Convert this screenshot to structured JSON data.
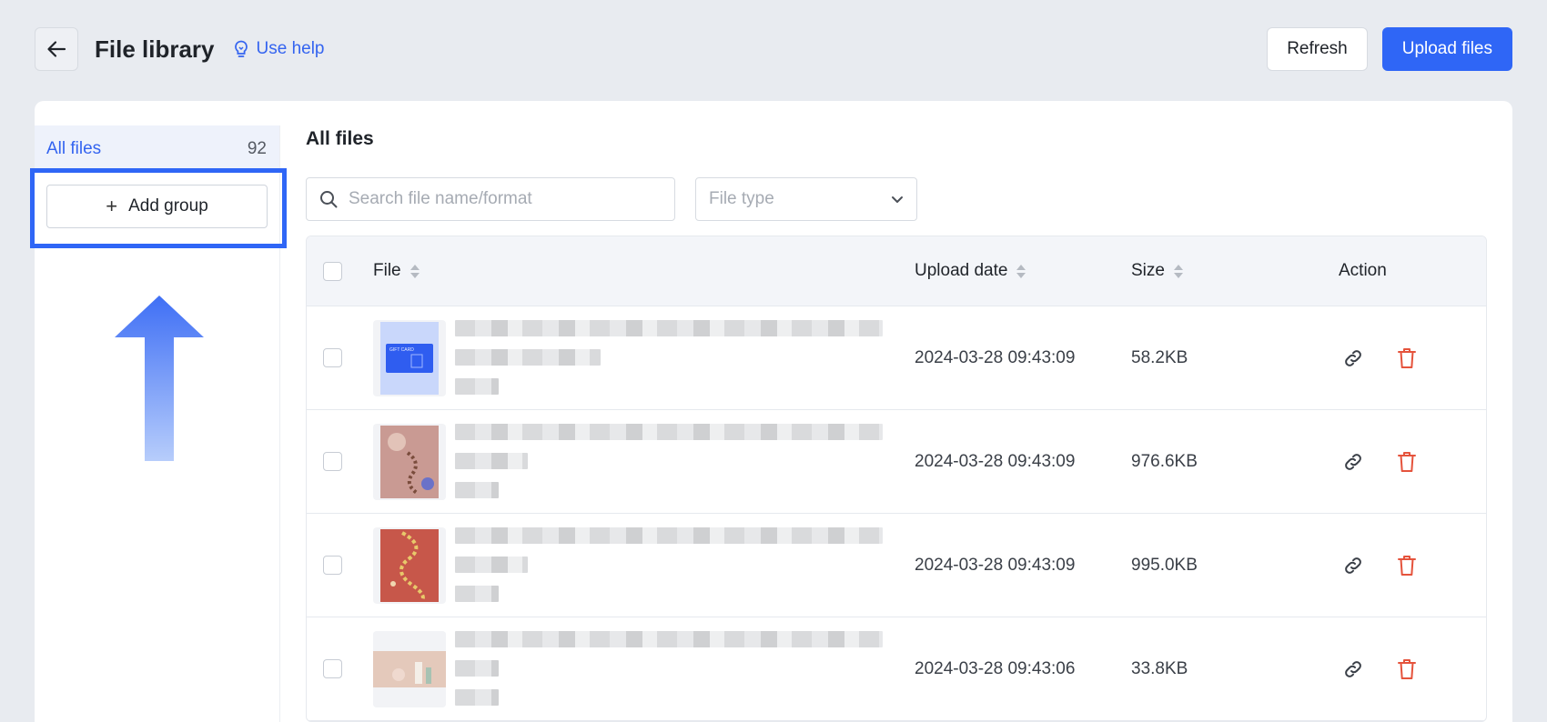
{
  "header": {
    "title": "File library",
    "help_label": "Use help",
    "refresh_label": "Refresh",
    "upload_label": "Upload files"
  },
  "sidebar": {
    "all_files_label": "All files",
    "all_files_count": "92",
    "add_group_label": "Add group"
  },
  "main": {
    "title": "All files",
    "search_placeholder": "Search file name/format",
    "file_type_placeholder": "File type"
  },
  "table": {
    "columns": {
      "file": "File",
      "upload_date": "Upload date",
      "size": "Size",
      "action": "Action"
    },
    "rows": [
      {
        "date": "2024-03-28 09:43:09",
        "size": "58.2KB"
      },
      {
        "date": "2024-03-28 09:43:09",
        "size": "976.6KB"
      },
      {
        "date": "2024-03-28 09:43:09",
        "size": "995.0KB"
      },
      {
        "date": "2024-03-28 09:43:06",
        "size": "33.8KB"
      }
    ]
  },
  "thumbnails": {
    "gift_card_text": "GIFT CARD"
  },
  "colors": {
    "accent": "#2f66f6",
    "delete": "#e5533c",
    "selected_bg": "#eef2fb"
  }
}
